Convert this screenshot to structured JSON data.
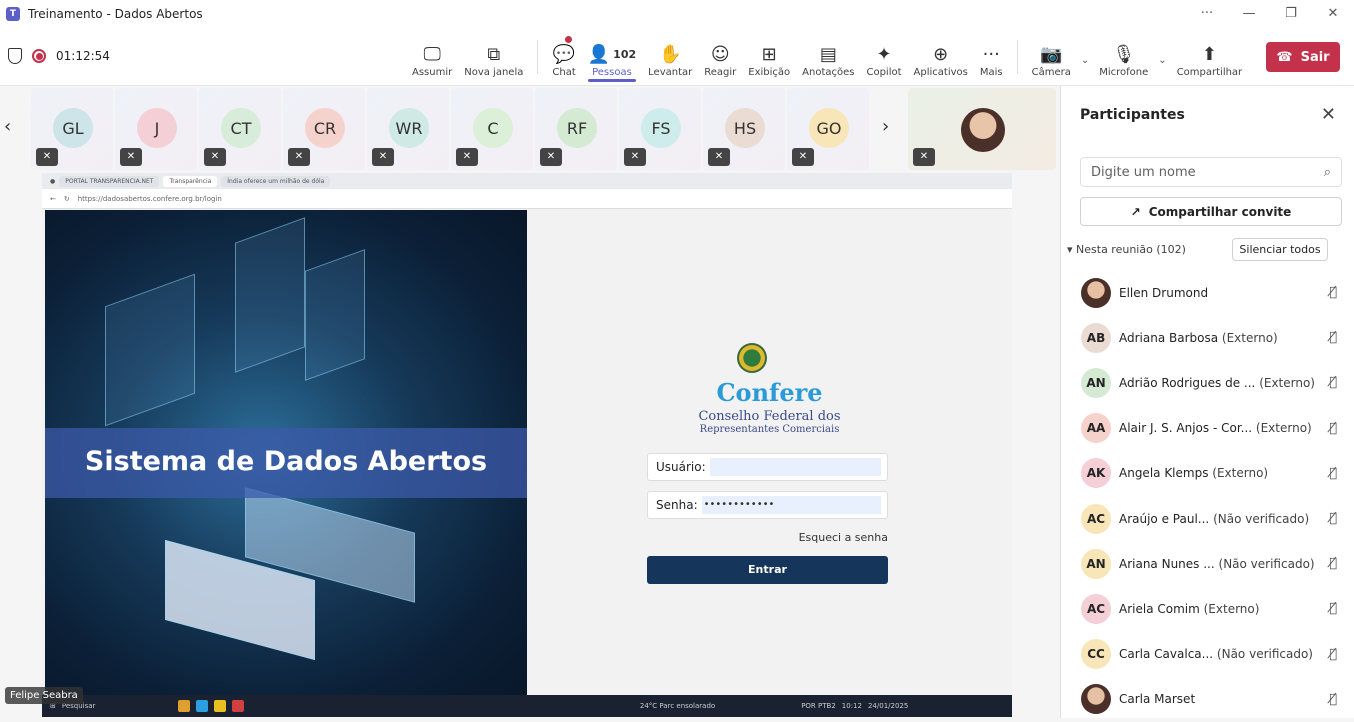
{
  "window": {
    "title": "Treinamento - Dados Abertos",
    "app_icon": "teams-icon",
    "controls": [
      "···",
      "—",
      "❐",
      "✕"
    ]
  },
  "meeting": {
    "timer": "01:12:54"
  },
  "toolbar": {
    "items": [
      {
        "label": "Assumir",
        "icon": "take-control-icon"
      },
      {
        "label": "Nova janela",
        "icon": "new-window-icon"
      },
      {
        "label": "Chat",
        "icon": "chat-icon"
      },
      {
        "label": "Pessoas",
        "icon": "people-icon",
        "count": "102"
      },
      {
        "label": "Levantar",
        "icon": "raise-hand-icon"
      },
      {
        "label": "Reagir",
        "icon": "react-icon"
      },
      {
        "label": "Exibição",
        "icon": "view-icon"
      },
      {
        "label": "Anotações",
        "icon": "notes-icon"
      },
      {
        "label": "Copilot",
        "icon": "copilot-icon"
      },
      {
        "label": "Aplicativos",
        "icon": "apps-icon"
      },
      {
        "label": "Mais",
        "icon": "more-icon"
      },
      {
        "label": "Câmera",
        "icon": "camera-off-icon"
      },
      {
        "label": "Microfone",
        "icon": "mic-off-icon"
      },
      {
        "label": "Compartilhar",
        "icon": "share-icon"
      }
    ],
    "leave_label": "Sair"
  },
  "participants_strip": [
    {
      "initials": "GL",
      "color": "#cde4e8"
    },
    {
      "initials": "J",
      "color": "#f4cfd6"
    },
    {
      "initials": "CT",
      "color": "#d7ecd9"
    },
    {
      "initials": "CR",
      "color": "#f6d2cd"
    },
    {
      "initials": "WR",
      "color": "#cfe9e5"
    },
    {
      "initials": "C",
      "color": "#dcefd8"
    },
    {
      "initials": "RF",
      "color": "#d4ead3"
    },
    {
      "initials": "FS",
      "color": "#cdeceb"
    },
    {
      "initials": "HS",
      "color": "#eadbd3"
    },
    {
      "initials": "GO",
      "color": "#f9e6b8"
    }
  ],
  "shared_screen": {
    "tabs": [
      "PORTAL TRANSPARENCIA.NET",
      "Transparência",
      "Índia oferece um milhão de dóla"
    ],
    "address": "https://dadosabertos.confere.org.br/login",
    "hero_title": "Sistema de Dados Abertos",
    "org_name": "Confere",
    "org_line1": "Conselho Federal dos",
    "org_line2": "Representantes Comerciais",
    "user_label": "Usuário:",
    "pass_label": "Senha:",
    "pass_value": "••••••••••••",
    "forgot_label": "Esqueci a senha",
    "submit_label": "Entrar",
    "taskbar_search": "Pesquisar",
    "taskbar_weather": "24°C Parc ensolarado",
    "taskbar_lang": "POR PTB2",
    "taskbar_time": "10:12",
    "taskbar_date": "24/01/2025"
  },
  "presenter_name": "Felipe Seabra",
  "panel": {
    "title": "Participantes",
    "search_placeholder": "Digite um nome",
    "share_invite": "Compartilhar convite",
    "group_label": "Nesta reunião (102)",
    "mute_all": "Silenciar todos",
    "people": [
      {
        "initials": "",
        "name": "Ellen Drumond",
        "tag": "",
        "photo": true,
        "color": ""
      },
      {
        "initials": "AB",
        "name": "Adriana Barbosa",
        "tag": "(Externo)",
        "photo": false,
        "color": "#eadbd3"
      },
      {
        "initials": "AN",
        "name": "Adrião Rodrigues de ...",
        "tag": "(Externo)",
        "photo": false,
        "color": "#d4ead3"
      },
      {
        "initials": "AA",
        "name": "Alair J. S. Anjos - Cor...",
        "tag": "(Externo)",
        "photo": false,
        "color": "#f6d2cd"
      },
      {
        "initials": "AK",
        "name": "Angela Klemps",
        "tag": "(Externo)",
        "photo": false,
        "color": "#f4cfd6"
      },
      {
        "initials": "AC",
        "name": "Araújo e Paul...",
        "tag": "(Não verificado)",
        "photo": false,
        "color": "#f9e6b8"
      },
      {
        "initials": "AN",
        "name": "Ariana Nunes ...",
        "tag": "(Não verificado)",
        "photo": false,
        "color": "#f9e6b8"
      },
      {
        "initials": "AC",
        "name": "Ariela Comim",
        "tag": "(Externo)",
        "photo": false,
        "color": "#f4cfd6"
      },
      {
        "initials": "CC",
        "name": "Carla Cavalca...",
        "tag": "(Não verificado)",
        "photo": false,
        "color": "#f9e6b8"
      },
      {
        "initials": "",
        "name": "Carla Marset",
        "tag": "",
        "photo": true,
        "color": ""
      }
    ]
  }
}
